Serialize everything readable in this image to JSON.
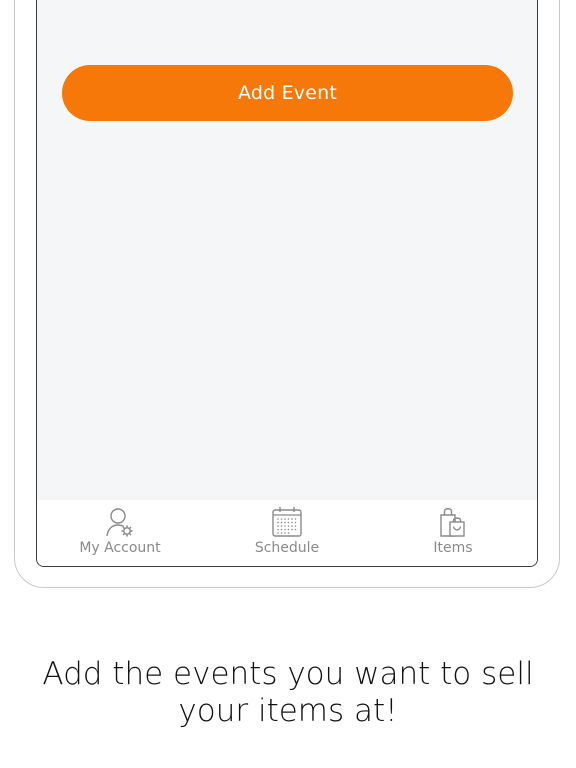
{
  "main": {
    "add_event_label": "Add Event"
  },
  "tab_bar": {
    "items": [
      {
        "label": "My Account",
        "icon": "account-settings-icon"
      },
      {
        "label": "Schedule",
        "icon": "calendar-icon"
      },
      {
        "label": "Items",
        "icon": "shopping-bag-icon"
      }
    ]
  },
  "caption": {
    "line1": "Add the events you want to sell",
    "line2": "your items at!"
  },
  "colors": {
    "accent": "#f57809",
    "screen_background": "#f5f6f7",
    "tab_label": "#8a8a8a"
  }
}
